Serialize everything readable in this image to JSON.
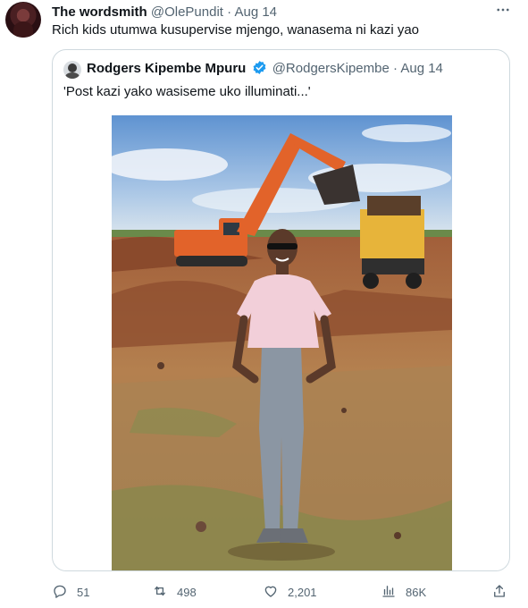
{
  "tweet": {
    "author_name": "The wordsmith",
    "author_handle": "@OlePundit",
    "separator": "·",
    "date": "Aug 14",
    "text": "Rich kids utumwa kusupervise mjengo, wanasema ni kazi yao",
    "more_icon": "more-horizontal-icon"
  },
  "quoted": {
    "author_name": "Rodgers Kipembe Mpuru",
    "author_handle": "@RodgersKipembe",
    "separator": "·",
    "date": "Aug 14",
    "text": "'Post kazi yako wasiseme uko illuminati...'",
    "verified_color": "#1d9bf0",
    "photo_alt": "Man in pink polo shirt and grey jeans standing on a construction site with an orange excavator and a yellow dump truck"
  },
  "actions": {
    "reply": {
      "icon": "reply-icon",
      "count": "51"
    },
    "retweet": {
      "icon": "retweet-icon",
      "count": "498"
    },
    "like": {
      "icon": "like-icon",
      "count": "2,201"
    },
    "views": {
      "icon": "views-icon",
      "count": "86K"
    },
    "share": {
      "icon": "share-icon"
    }
  },
  "colors": {
    "text": "#0f1419",
    "muted": "#536471",
    "border": "#cfd9de",
    "verified": "#1d9bf0"
  }
}
